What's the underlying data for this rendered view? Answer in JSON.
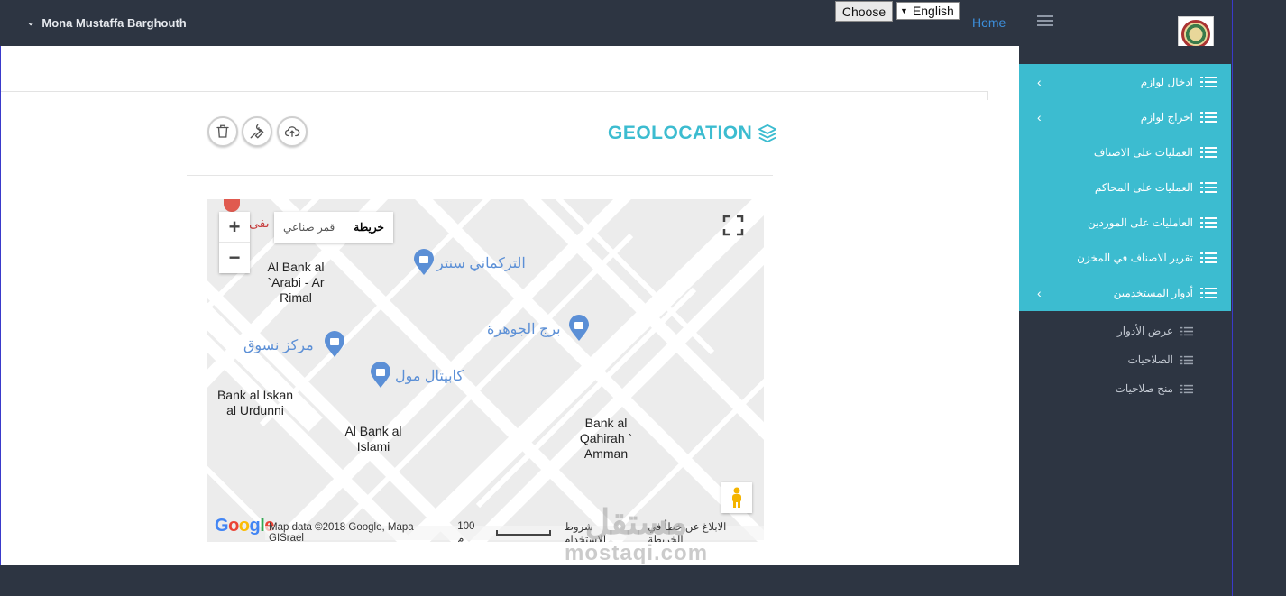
{
  "topbar": {
    "user_name": "Mona Mustaffa Barghouth",
    "choose_label": "Choose",
    "language": "English",
    "home_label": "Home"
  },
  "panel": {
    "title": "GEOLOCATION"
  },
  "map": {
    "type_satellite": "قمر صناعي",
    "type_map": "خريطة",
    "partial_label": "ىفى",
    "pois": [
      {
        "text": "التركماني سنتر",
        "style": "blue"
      },
      {
        "text": "برج الجوهرة",
        "style": "blue"
      },
      {
        "text": "مركز نسوق",
        "style": "blue"
      },
      {
        "text": "كابيتال مول",
        "style": "blue"
      },
      {
        "text": "Al Bank al `Arabi - Ar Rimal",
        "style": "dark"
      },
      {
        "text": "Bank al Iskan al Urdunni",
        "style": "dark"
      },
      {
        "text": "Al Bank al Islami",
        "style": "dark"
      },
      {
        "text": "Bank al Qahirah ` Amman",
        "style": "dark"
      }
    ],
    "footer_data": "Map data ©2018 Google, Mapa GISrael",
    "scale_label": "100 م",
    "terms_label": "شروط الاستخدام",
    "report_label": "الابلاغ عن خطأ في الخريطة",
    "google_letters": [
      "G",
      "o",
      "o",
      "g",
      "l",
      "e"
    ]
  },
  "sidebar": {
    "items": [
      {
        "label": "ادخال لوازم",
        "has_arrow": true
      },
      {
        "label": "اخراج لوازم",
        "has_arrow": true
      },
      {
        "label": "العمليات على الاصناف",
        "has_arrow": false
      },
      {
        "label": "العمليات على المحاكم",
        "has_arrow": false
      },
      {
        "label": "العامليات على الموردين",
        "has_arrow": false
      },
      {
        "label": "تقرير الاصناف في المخزن",
        "has_arrow": false
      },
      {
        "label": "أدوار المستخدمين",
        "has_arrow": true
      }
    ],
    "sub_items": [
      {
        "label": "عرض الأدوار"
      },
      {
        "label": "الصلاحيات"
      },
      {
        "label": "منح صلاحيات"
      }
    ]
  },
  "watermark": {
    "arabic": "مستقل",
    "latin": "mostaqi.com"
  },
  "colors": {
    "accent": "#3cbcd0",
    "dark_bg": "#2d3542",
    "link": "#3c8fdc"
  }
}
